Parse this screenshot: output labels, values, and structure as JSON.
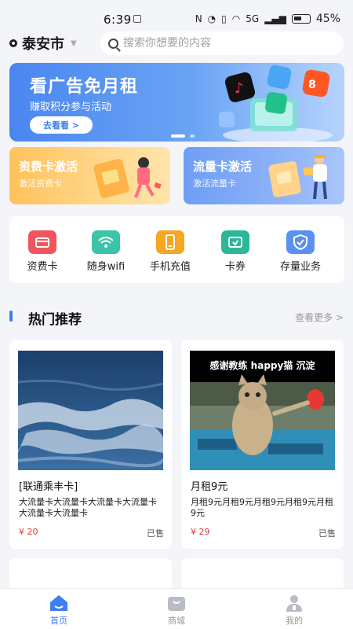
{
  "status_bar": {
    "time": "6:39",
    "network_label": "5G",
    "battery_percent": "45%"
  },
  "header": {
    "city": "泰安市",
    "search_placeholder": "搜索你想要的内容"
  },
  "banner": {
    "title": "看广告免月租",
    "subtitle": "赚取积分参与活动",
    "cta": "去看看 >",
    "active_slide": 1,
    "slide_count": 2
  },
  "promo_cards": [
    {
      "title": "资费卡激活",
      "subtitle": "激活资费卡"
    },
    {
      "title": "流量卡激活",
      "subtitle": "激活流量卡"
    }
  ],
  "services": [
    {
      "label": "资费卡",
      "icon": "card-icon",
      "color": "#f0555e"
    },
    {
      "label": "随身wifi",
      "icon": "wifi-icon",
      "color": "#3cc4a9"
    },
    {
      "label": "手机充值",
      "icon": "phone-icon",
      "color": "#f5a623"
    },
    {
      "label": "卡券",
      "icon": "coupon-icon",
      "color": "#2bb89a"
    },
    {
      "label": "存量业务",
      "icon": "badge-icon",
      "color": "#5b8ff0"
    }
  ],
  "section": {
    "title": "热门推荐",
    "more": "查看更多 >"
  },
  "products": [
    {
      "name": "[联通乘丰卡]",
      "desc": "大流量卡大流量卡大流量卡大流量卡大流量卡大流量卡",
      "price": "¥ 20",
      "sold": "已售"
    },
    {
      "name": "月租9元",
      "desc": "月租9元月租9元月租9元月租9元月租9元",
      "price": "¥ 29",
      "sold": "已售",
      "image_caption": "感谢教练 happy猫 沉淀"
    }
  ],
  "tabs": [
    {
      "label": "首页",
      "active": true
    },
    {
      "label": "商城",
      "active": false
    },
    {
      "label": "我的",
      "active": false
    }
  ],
  "colors": {
    "accent": "#3d7ef2",
    "price": "#e53935",
    "background": "#f4f5f8"
  }
}
